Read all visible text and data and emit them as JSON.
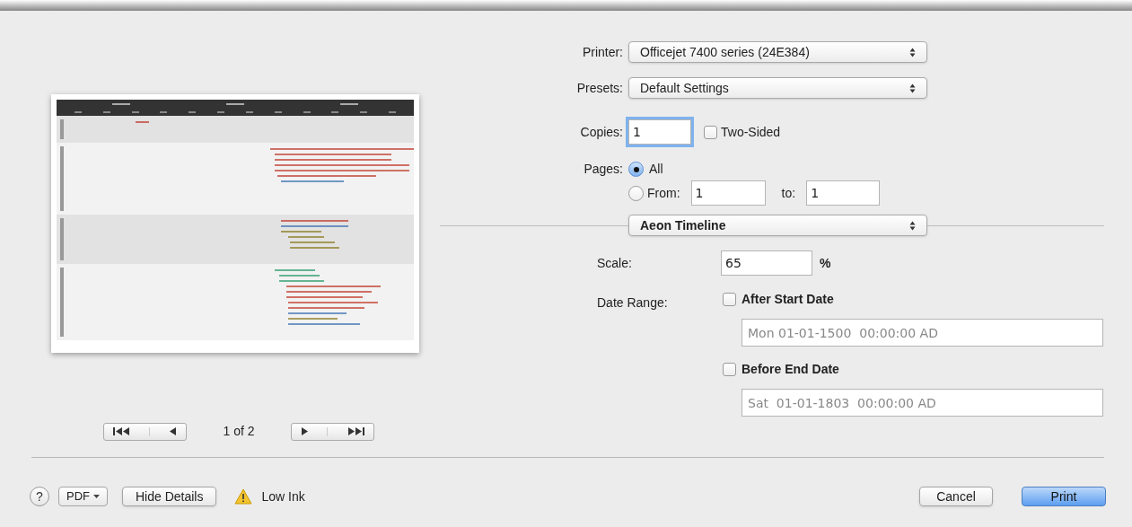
{
  "printer": {
    "label": "Printer:",
    "value": "Officejet 7400 series (24E384)"
  },
  "presets": {
    "label": "Presets:",
    "value": "Default Settings"
  },
  "copies": {
    "label": "Copies:",
    "value": "1",
    "focused": true
  },
  "two_sided": {
    "label": "Two-Sided",
    "checked": false
  },
  "pages": {
    "label": "Pages:",
    "options": [
      {
        "label": "All",
        "selected": true
      },
      {
        "label": "From:",
        "selected": false
      }
    ],
    "from": "1",
    "to_label": "to:",
    "to": "1"
  },
  "panel_select": {
    "value": "Aeon Timeline"
  },
  "scale": {
    "label": "Scale:",
    "value": "65",
    "unit": "%"
  },
  "date_range": {
    "label": "Date Range:",
    "items": [
      {
        "label": "After Start Date",
        "checked": false,
        "value": "Mon 01-01-1500  00:00:00 AD"
      },
      {
        "label": "Before End Date",
        "checked": false,
        "value": "Sat  01-01-1803  00:00:00 AD"
      }
    ]
  },
  "page_nav": {
    "text": "1 of 2"
  },
  "bottom_bar": {
    "help": "?",
    "pdf": "PDF",
    "hide_details": "Hide Details",
    "warning": "Low Ink",
    "cancel": "Cancel",
    "print": "Print"
  }
}
